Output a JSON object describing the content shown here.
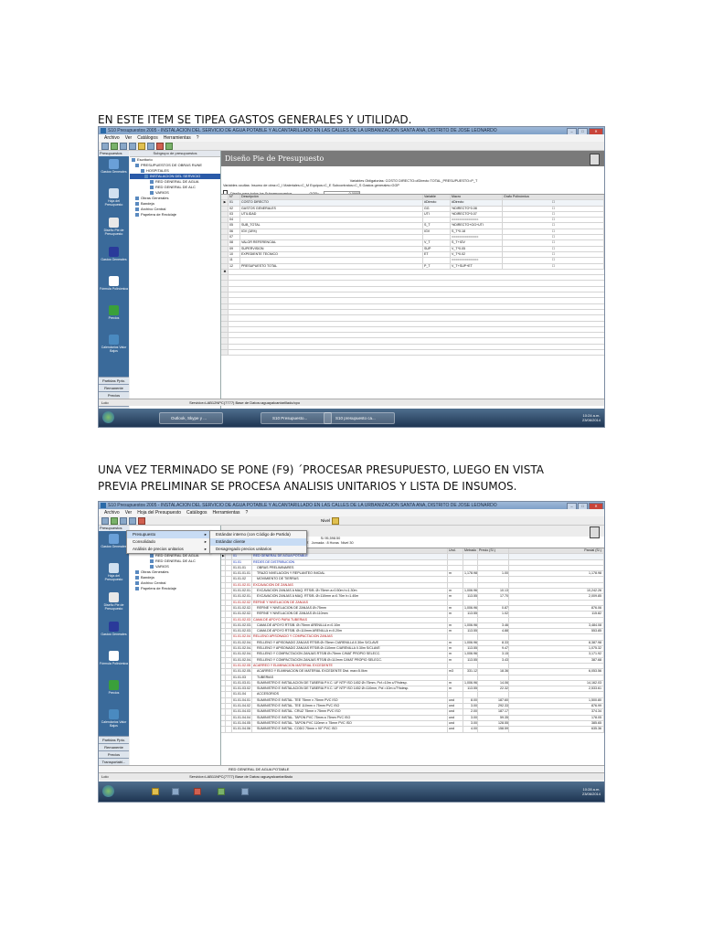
{
  "instructions": {
    "first": "EN ESTE ITEM SE TIPEA GASTOS GENERALES Y UTILIDAD.",
    "second": "UNA VEZ TERMINADO SE PONE (F9) ´PROCESAR PRESUPUESTO, LUEGO EN VISTA PREVIA PRELIMINAR SE PROCESA ANALISIS UNITARIOS Y LISTA DE INSUMOS."
  },
  "screenshot1": {
    "window_title": "S10 Presupuestos 2005 - INSTALACION DEL SERVICIO DE AGUA POTABLE Y ALCANTARILLADO EN LAS CALLES DE LA URBANIZACION SANTA ANA, DISTRITO DE JOSE LEONARDO",
    "menu": [
      "Archivo",
      "Ver",
      "Catálogos",
      "Herramientas",
      "?"
    ],
    "sidebar_header": "Presupuestos",
    "sidebar_items": [
      "Gastos Generales",
      "Hoja del Presupuesto",
      "Diseño Pie de Presupuesto",
      "Gastos Generales",
      "Fórmula Polinómica",
      "Precios",
      "Calendarios Valor Bajos"
    ],
    "sidebar_buttons": [
      "Partidas Ppto.",
      "Remanente",
      "Precios",
      "Transportabl...",
      "Utilitarios"
    ],
    "tree_header": "Subgrupo de presupuestos",
    "tree": [
      "Escritorio",
      "PRESUPUESTOS DE OBRAS RUNE",
      "HOSPITALES",
      "INSTALACION DEL SERVICIO",
      "RED GENERAL DE AGUA",
      "RED GENERAL DE ALC",
      "VARIOS",
      "Obras Generales",
      "Bandeja",
      "Archivo Central",
      "Papelera de Reciclaje"
    ],
    "design_title": "Diseño Pie de Presupuesto",
    "info_line1": "Variables Obligatorias: COSTO DIRECTO=#Directo    TOTAL_PRESUPUESTO=P_T",
    "info_line2": "Variables ocultas: Insumo de obra=C_I   Materiales=C_M   Equipos=C_E   Subcontratos=C_S   Gastos generales=GGP",
    "checkbox_label": "Diseño para todos los Subpresupuestos",
    "ggp_label": "GGP=",
    "ggp_value": "0.0000",
    "columns": [
      "N°",
      "Línea",
      "Descripción",
      "Variable",
      "Macro",
      "Grafo Polinómica"
    ],
    "rows": [
      {
        "n": "01",
        "desc": "COSTO DIRECTO",
        "var": "#Directo",
        "macro": "#Directo"
      },
      {
        "n": "02",
        "desc": "GASTOS GENERALES",
        "var": "GG",
        "macro": "%DIRECTO*0.08"
      },
      {
        "n": "03",
        "desc": "UTILIDAD",
        "var": "UTI",
        "macro": "%DIRECTO*0.07"
      },
      {
        "n": "04",
        "desc": "",
        "var": "",
        "macro": "=============="
      },
      {
        "n": "05",
        "desc": "SUB_TOTAL",
        "var": "S_T",
        "macro": "%DIRECTO+GG+UTI"
      },
      {
        "n": "06",
        "desc": "IGV (18%)",
        "var": "IGV",
        "macro": "S_T*0.18"
      },
      {
        "n": "07",
        "desc": "",
        "var": "",
        "macro": "=============="
      },
      {
        "n": "08",
        "desc": "VALOR REFERENCIAL",
        "var": "V_T",
        "macro": "S_T+IGV"
      },
      {
        "n": "09",
        "desc": "SUPERVISION",
        "var": "SUP",
        "macro": "V_T*0.05"
      },
      {
        "n": "10",
        "desc": "EXPEDIENTE TECNICO",
        "var": "ET",
        "macro": "V_T*0.02"
      },
      {
        "n": "11",
        "desc": "",
        "var": "",
        "macro": "=============="
      },
      {
        "n": "12",
        "desc": "PRESUPUESTO TOTAL",
        "var": "P_T",
        "macro": "V_T+SUP+ET"
      }
    ],
    "status_user": "Lolo",
    "status_server": "Servidor=LAB12NPC(7777)  Base de Datos=aguayalcantarillado/cpo",
    "taskbar": [
      "Outlook, Skype y ...",
      "S10 Presupuesto...",
      "S10 presupuesto ca..."
    ],
    "clock_time": "10:24 a.m.",
    "clock_date": "23/06/2014"
  },
  "screenshot2": {
    "window_title": "S10 Presupuestos 2005 - INSTALACION DEL SERVICIO DE AGUA POTABLE Y ALCANTARILLADO EN LAS CALLES DE LA URBANIZACION SANTA ANA, DISTRITO DE JOSE LEONARDO",
    "menu": [
      "Archivo",
      "Ver",
      "Hoja del Presupuesto",
      "Catálogos",
      "Herramientas",
      "?"
    ],
    "popup_main": [
      "Presupuesto",
      "Consolidado",
      "Análisis de precios unitarios"
    ],
    "popup_sub": [
      "Estándar interno (con Código de Partida)",
      "Estándar cliente",
      "Desagregado precios unitarios"
    ],
    "toolbar_nivel": "Nivel",
    "header_cd": "C.D.",
    "header_total": "S/.95,598.50",
    "header_fecha": "Fecha : 30/06/2014",
    "header_lugar": "Lugar : JOSE LEONARDO ORTIZ",
    "header_jornada": "Jornada : 8 Horas",
    "header_nivel": "Nivel 30",
    "columns": [
      "Item",
      "Descripción",
      "Und.",
      "Metrado",
      "Precio (S/.)",
      "Parcial (S/.)"
    ],
    "rows": [
      {
        "item": "01",
        "desc": "RED GENERAL DE AGUA POTABLE",
        "und": "",
        "met": "",
        "pre": "",
        "par": "",
        "cls": "blue"
      },
      {
        "item": "01.01",
        "desc": "REDES DE DISTRIBUCION",
        "und": "",
        "met": "",
        "pre": "",
        "par": "",
        "cls": "blue"
      },
      {
        "item": "01.01.01",
        "desc": "OBRAS PRELIMINARES",
        "und": "",
        "met": "",
        "pre": "",
        "par": "",
        "cls": ""
      },
      {
        "item": "01.01.01.01",
        "desc": "TRAZO NIVELACION Y REPLANTEO INICIAL",
        "und": "m",
        "met": "1,178.98",
        "pre": "1.00",
        "par": "1,178.98",
        "cls": ""
      },
      {
        "item": "01.01.02",
        "desc": "MOVIMIENTO DE TIERRAS",
        "und": "",
        "met": "",
        "pre": "",
        "par": "",
        "cls": ""
      },
      {
        "item": "01.01.02.01",
        "desc": "EXCAVACION DE ZANJAS",
        "und": "",
        "met": "",
        "pre": "",
        "par": "",
        "cls": "red"
      },
      {
        "item": "01.01.02.01.01",
        "desc": "EXCAVACION ZANJAS A MAQ. RTS/B. Ø=75mm a=0.50m h=1.30m",
        "und": "m",
        "met": "1,006.96",
        "pre": "10.13",
        "par": "10,242.26",
        "cls": ""
      },
      {
        "item": "01.01.02.01.02",
        "desc": "EXCAVACION ZANJAS A MAQ. RTS/B. Ø=110mm a=0.70m h=1.40m",
        "und": "m",
        "met": "113.55",
        "pre": "17.70",
        "par": "2,009.85",
        "cls": ""
      },
      {
        "item": "01.01.02.02",
        "desc": "REFINE Y NIVELACION DE ZANJAS",
        "und": "",
        "met": "",
        "pre": "",
        "par": "",
        "cls": "red"
      },
      {
        "item": "01.01.02.02.01",
        "desc": "REFINE Y NIVELACION DE ZANJAS Ø=75mm",
        "und": "m",
        "met": "1,006.96",
        "pre": "0.87",
        "par": "876.06",
        "cls": ""
      },
      {
        "item": "01.01.02.02.02",
        "desc": "REFINE Y NIVELACION DE ZANJAS Ø=110mm",
        "und": "m",
        "met": "113.55",
        "pre": "1.02",
        "par": "115.82",
        "cls": ""
      },
      {
        "item": "01.01.02.03",
        "desc": "CAMA DE APOYO PARA TUBERIAS",
        "und": "",
        "met": "",
        "pre": "",
        "par": "",
        "cls": "red"
      },
      {
        "item": "01.01.02.03.01",
        "desc": "CAMA DE APOYO RTS/B. Ø=75mm ARENILLA e=0.10m",
        "und": "m",
        "met": "1,006.96",
        "pre": "3.46",
        "par": "3,484.08",
        "cls": ""
      },
      {
        "item": "01.01.02.03.02",
        "desc": "CAMA DE APOYO RTS/B. Ø=110mm ARENILLA e=0.20m",
        "und": "m",
        "met": "113.55",
        "pre": "4.88",
        "par": "553.85",
        "cls": ""
      },
      {
        "item": "01.01.02.04",
        "desc": "RELLENO APISONADO Y COMPACTACION ZANJAS",
        "und": "",
        "met": "",
        "pre": "",
        "par": "",
        "cls": "red"
      },
      {
        "item": "01.01.02.04.01",
        "desc": "RELLENO Y APISONADO ZANJAS RTS/B Ø=75mm C/ARENILLA 0.30m S/CLAVE",
        "und": "m",
        "met": "1,006.96",
        "pre": "8.33",
        "par": "8,387.98",
        "cls": ""
      },
      {
        "item": "01.01.02.04.02",
        "desc": "RELLENO Y APISONADO ZANJAS RTS/B Ø=110mm C/ARENILLA 0.30m S/CLAVE",
        "und": "m",
        "met": "113.55",
        "pre": "9.47",
        "par": "1,075.32",
        "cls": ""
      },
      {
        "item": "01.01.02.04.03",
        "desc": "RELLENO Y COMPACTACION ZANJAS RTS/B Ø=75mm C/MAT PROPIO SELECC.",
        "und": "m",
        "met": "1,006.96",
        "pre": "3.15",
        "par": "3,171.92",
        "cls": ""
      },
      {
        "item": "01.01.02.04.04",
        "desc": "RELLENO Y COMPACTACION ZANJAS RTS/B Ø=110mm C/MAT PROPIO SELECC.",
        "und": "m",
        "met": "113.55",
        "pre": "3.43",
        "par": "387.68",
        "cls": ""
      },
      {
        "item": "01.01.02.05",
        "desc": "ACARREO Y ELIMINACION MATERIAL EXCEDENTE",
        "und": "",
        "met": "",
        "pre": "",
        "par": "",
        "cls": "red"
      },
      {
        "item": "01.01.02.05.01",
        "desc": "ACARREO Y ELIMINACION DE MATERIAL EXCEDENTE Dist. max=5.0km",
        "und": "m3",
        "met": "331.12",
        "pre": "18.36",
        "par": "6,053.56",
        "cls": ""
      },
      {
        "item": "01.01.03",
        "desc": "TUBERIAS",
        "und": "",
        "met": "",
        "pre": "",
        "par": "",
        "cls": ""
      },
      {
        "item": "01.01.03.01",
        "desc": "SUMINISTRO E INSTALACION DE TUBERIA P.V.C. UF NTP ISO 1452 Ø=75mm, Pcf.=10m c/7%desp.",
        "und": "m",
        "met": "1,006.96",
        "pre": "14.06",
        "par": "14,162.03",
        "cls": ""
      },
      {
        "item": "01.01.03.02",
        "desc": "SUMINISTRO E INSTALACION DE TUBERIA P.V.C. UF NTP ISO 1452 Ø=110mm, Pcf.=10m c/7%desp.",
        "und": "m",
        "met": "113.55",
        "pre": "22.32",
        "par": "2,533.61",
        "cls": ""
      },
      {
        "item": "01.01.04",
        "desc": "ACCESORIOS",
        "und": "",
        "met": "",
        "pre": "",
        "par": "",
        "cls": ""
      },
      {
        "item": "01.01.04.01",
        "desc": "SUMINISTRO E INSTAL. TEE 75mm x 75mm PVC ISO",
        "und": "und",
        "met": "8.00",
        "pre": "187.60",
        "par": "1,500.80",
        "cls": ""
      },
      {
        "item": "01.01.04.02",
        "desc": "SUMINISTRO E INSTAL. TEE 110mm x 75mm PVC ISO",
        "und": "und",
        "met": "3.00",
        "pre": "292.33",
        "par": "876.99",
        "cls": ""
      },
      {
        "item": "01.01.04.03",
        "desc": "SUMINISTRO E INSTAL. CRUZ 75mm x 75mm PVC ISO",
        "und": "und",
        "met": "2.00",
        "pre": "187.17",
        "par": "374.34",
        "cls": ""
      },
      {
        "item": "01.01.04.04",
        "desc": "SUMINISTRO E INSTAL. TAPON PVC 75mm a 75mm PVC ISO",
        "und": "und",
        "met": "3.00",
        "pre": "59.35",
        "par": "178.05",
        "cls": ""
      },
      {
        "item": "01.01.04.05",
        "desc": "SUMINISTRO E INSTAL. TAPON PVC 110mm x 75mm PVC ISO",
        "und": "und",
        "met": "3.00",
        "pre": "128.55",
        "par": "385.65",
        "cls": ""
      },
      {
        "item": "01.01.04.06",
        "desc": "SUMINISTRO E INSTAL. CODO 75mm x 90° PVC ISO",
        "und": "und",
        "met": "4.00",
        "pre": "158.59",
        "par": "635.36",
        "cls": ""
      }
    ],
    "footer": "RED GENERAL DE AGUA POTABLE",
    "status_user": "Lolo",
    "status_server": "Servidor=LAB11NPC(7777)  Base de Datos=aguayalcantarillado",
    "clock_time": "10:28 a.m.",
    "clock_date": "23/06/2014"
  }
}
